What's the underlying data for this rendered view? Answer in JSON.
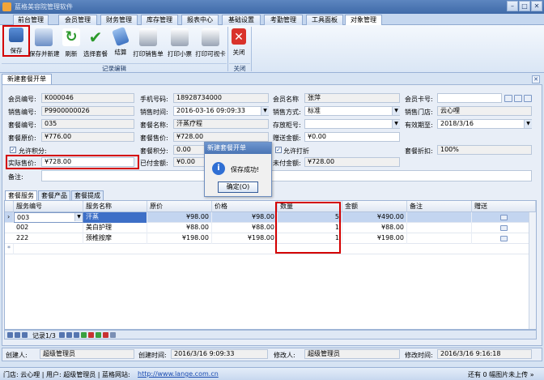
{
  "app": {
    "title": "蓝格美容院管理软件"
  },
  "window_buttons": [
    "–",
    "□",
    "✕"
  ],
  "menu_tabs": [
    "前台管理",
    "会员管理",
    "财务管理",
    "库存管理",
    "报表中心",
    "基础设置",
    "考勤管理",
    "工具面板",
    "对象管理"
  ],
  "toolbar": {
    "save": "保存",
    "save_new": "保存并新建",
    "refresh": "刷新",
    "select_package": "选择套餐",
    "checkout": "结算",
    "print_sales": "打印销售单",
    "print_receipt": "打印小票",
    "print_card": "打印可视卡",
    "close": "关闭",
    "group_edit": "记录编辑",
    "group_close": "关闭"
  },
  "doc_tab": "新建套餐开单",
  "form": {
    "member_no_label": "会员编号:",
    "member_no": "K000046",
    "mobile_label": "手机号码:",
    "mobile": "18928734000",
    "member_name_label": "会员名称",
    "member_name": "张萍",
    "member_card_label": "会员卡号:",
    "member_card": "",
    "sales_no_label": "销售编号:",
    "sales_no": "P9900000026",
    "sales_time_label": "销售时间:",
    "sales_time": "2016-03-16 09:09:33",
    "sales_method_label": "销售方式:",
    "sales_method": "标准",
    "sales_store_label": "销售门店:",
    "sales_store": "云心哩",
    "package_no_label": "套餐编号:",
    "package_no": "035",
    "package_name_label": "套餐名称:",
    "package_name": "汗蒸疗程",
    "cabinet_label": "存放柜号:",
    "cabinet": "",
    "valid_until_label": "有效期至:",
    "valid_until": "2018/3/16",
    "original_price_label": "套餐原价:",
    "original_price": "¥776.00",
    "sale_price_label": "套餐售价:",
    "sale_price": "¥728.00",
    "gift_amount_label": "赠送金额:",
    "gift_amount": "¥0.00",
    "allow_points_label": "允许积分:",
    "package_points_label": "套餐积分:",
    "package_points": "0.00",
    "allow_discount_label": "允许打折",
    "package_discount_label": "套餐折扣:",
    "package_discount": "100%",
    "actual_price_label": "实际售价:",
    "actual_price": "¥728.00",
    "paid_label": "已付金额:",
    "paid": "¥0.00",
    "unpaid_label": "未付金额:",
    "unpaid": "¥728.00",
    "note_label": "备注:",
    "note": ""
  },
  "sub_tabs": [
    "套餐服务",
    "套餐产品",
    "套餐提成"
  ],
  "grid": {
    "headers": [
      "服务编号",
      "服务名称",
      "原价",
      "价格",
      "数量",
      "金额",
      "备注",
      "赠送"
    ],
    "rows": [
      {
        "code": "003",
        "name": "汗蒸",
        "orig": "¥98.00",
        "price": "¥98.00",
        "qty": "5",
        "amount": "¥490.00",
        "note": ""
      },
      {
        "code": "002",
        "name": "美白护理",
        "orig": "¥88.00",
        "price": "¥88.00",
        "qty": "1",
        "amount": "¥88.00",
        "note": ""
      },
      {
        "code": "222",
        "name": "颈椎按摩",
        "orig": "¥198.00",
        "price": "¥198.00",
        "qty": "1",
        "amount": "¥198.00",
        "note": ""
      }
    ],
    "current_marker": "›",
    "new_row_marker": "*"
  },
  "navigator": {
    "record_text": "记录1/3"
  },
  "footer": {
    "creator_label": "创建人:",
    "creator": "超级管理员",
    "created_label": "创建时间:",
    "created": "2016/3/16 9:09:33",
    "modifier_label": "修改人:",
    "modifier": "超级管理员",
    "modified_label": "修改时间:",
    "modified": "2016/3/16 9:16:18"
  },
  "status": {
    "text": "门店: 云心哩 | 用户: 超级管理员 | 蓝格网站:",
    "url": "http://www.lange.com.cn",
    "right": "还有 0 幅图片未上传 »"
  },
  "dialog": {
    "title": "新建套餐开单",
    "icon": "i",
    "message": "保存成功!",
    "ok": "确定(O)"
  }
}
